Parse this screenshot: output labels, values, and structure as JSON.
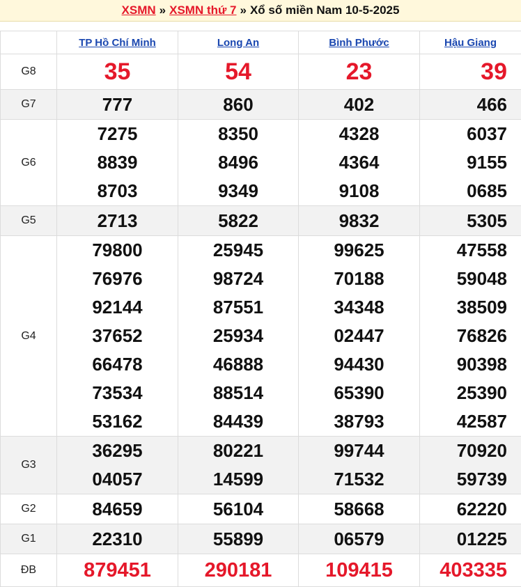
{
  "title": {
    "link1": "XSMN",
    "sep1": "»",
    "link2": "XSMN thứ 7",
    "sep2": "»",
    "text": "Xổ số miền Nam 10-5-2025"
  },
  "provinces": [
    "TP Hồ Chí Minh",
    "Long An",
    "Bình Phước",
    "Hậu Giang"
  ],
  "prizes": [
    {
      "id": "g8",
      "label": "G8",
      "values": [
        [
          "35"
        ],
        [
          "54"
        ],
        [
          "23"
        ],
        [
          "39"
        ]
      ]
    },
    {
      "id": "g7",
      "label": "G7",
      "values": [
        [
          "777"
        ],
        [
          "860"
        ],
        [
          "402"
        ],
        [
          "466"
        ]
      ]
    },
    {
      "id": "g6",
      "label": "G6",
      "values": [
        [
          "7275",
          "8839",
          "8703"
        ],
        [
          "8350",
          "8496",
          "9349"
        ],
        [
          "4328",
          "4364",
          "9108"
        ],
        [
          "6037",
          "9155",
          "0685"
        ]
      ]
    },
    {
      "id": "g5",
      "label": "G5",
      "values": [
        [
          "2713"
        ],
        [
          "5822"
        ],
        [
          "9832"
        ],
        [
          "5305"
        ]
      ]
    },
    {
      "id": "g4",
      "label": "G4",
      "values": [
        [
          "79800",
          "76976",
          "92144",
          "37652",
          "66478",
          "73534",
          "53162"
        ],
        [
          "25945",
          "98724",
          "87551",
          "25934",
          "46888",
          "88514",
          "84439"
        ],
        [
          "99625",
          "70188",
          "34348",
          "02447",
          "94430",
          "65390",
          "38793"
        ],
        [
          "47558",
          "59048",
          "38509",
          "76826",
          "90398",
          "25390",
          "42587"
        ]
      ]
    },
    {
      "id": "g3",
      "label": "G3",
      "values": [
        [
          "36295",
          "04057"
        ],
        [
          "80221",
          "14599"
        ],
        [
          "99744",
          "71532"
        ],
        [
          "70920",
          "59739"
        ]
      ]
    },
    {
      "id": "g2",
      "label": "G2",
      "values": [
        [
          "84659"
        ],
        [
          "56104"
        ],
        [
          "58668"
        ],
        [
          "62220"
        ]
      ]
    },
    {
      "id": "g1",
      "label": "G1",
      "values": [
        [
          "22310"
        ],
        [
          "55899"
        ],
        [
          "06579"
        ],
        [
          "01225"
        ]
      ]
    },
    {
      "id": "db",
      "label": "ĐB",
      "values": [
        [
          "879451"
        ],
        [
          "290181"
        ],
        [
          "109415"
        ],
        [
          "403335"
        ]
      ]
    }
  ],
  "colors": {
    "accent_red": "#e5182a",
    "link_blue": "#1a47b0",
    "title_bg": "#fff8dc",
    "row_shade": "#f2f2f2"
  }
}
